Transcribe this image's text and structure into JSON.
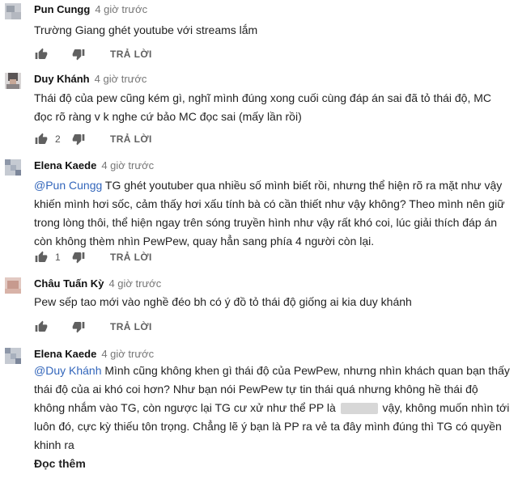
{
  "comments": [
    {
      "author": "Pun Cungg",
      "time": "4 giờ trước",
      "text": "Trường Giang ghét youtube với streams lắm",
      "likes": "",
      "reply": "TRẢ LỜI"
    },
    {
      "author": "Duy Khánh",
      "time": "4 giờ trước",
      "text": "Thái độ của pew cũng kém gì, nghĩ mình đúng xong cuối cùng đáp án sai đã tỏ thái độ, MC đọc rõ ràng v k nghe cứ bảo MC đọc sai (mấy lần rồi)",
      "likes": "2",
      "reply": "TRẢ LỜI"
    },
    {
      "author": "Elena Kaede",
      "time": "4 giờ trước",
      "mention": "@Pun Cungg",
      "text": " TG ghét youtuber qua nhiều số mình biết rồi, nhưng thể hiện rõ ra mặt như vậy khiến mình hơi sốc, cảm thấy hơi xấu tính bà có cần thiết như vậy không? Theo mình nên giữ trong lòng thôi, thể hiện ngay trên sóng truyền hình như vậy rất khó coi, lúc giải thích đáp án còn không thèm nhìn PewPew, quay hẳn sang phía 4 người còn lại.",
      "likes": "1",
      "reply": "TRẢ LỜI"
    },
    {
      "author": "Châu Tuấn Kỳ",
      "time": "4 giờ trước",
      "text": "Pew sếp tao mới vào nghề đéo bh có ý đồ tỏ thái độ giống ai kia  duy khánh",
      "likes": "",
      "reply": "TRẢ LỜI"
    },
    {
      "author": "Elena Kaede",
      "time": "4 giờ trước",
      "mention": "@Duy Khánh",
      "text_before": " Mình cũng không khen gì thái độ của PewPew, nhưng nhìn khách quan bạn thấy thái độ của ai khó coi hơn? Như bạn nói PewPew tự tin thái quá nhưng không hề thái độ không nhắm vào TG, còn ngược lại TG cư xử như thể PP là ",
      "text_after": " vậy, không muốn nhìn tới luôn đó, cực kỳ thiếu tôn trọng. Chẳng lẽ ý bạn là PP ra vẻ ta đây mình đúng thì TG có quyền khinh ra",
      "read_more": "Đọc thêm"
    }
  ],
  "colors": {
    "author": "#111111",
    "time": "#767676",
    "mention": "#3366bb",
    "icon": "#606060"
  },
  "icons": {
    "like": "thumbs-up-icon",
    "dislike": "thumbs-down-icon",
    "avatar": "avatar"
  }
}
